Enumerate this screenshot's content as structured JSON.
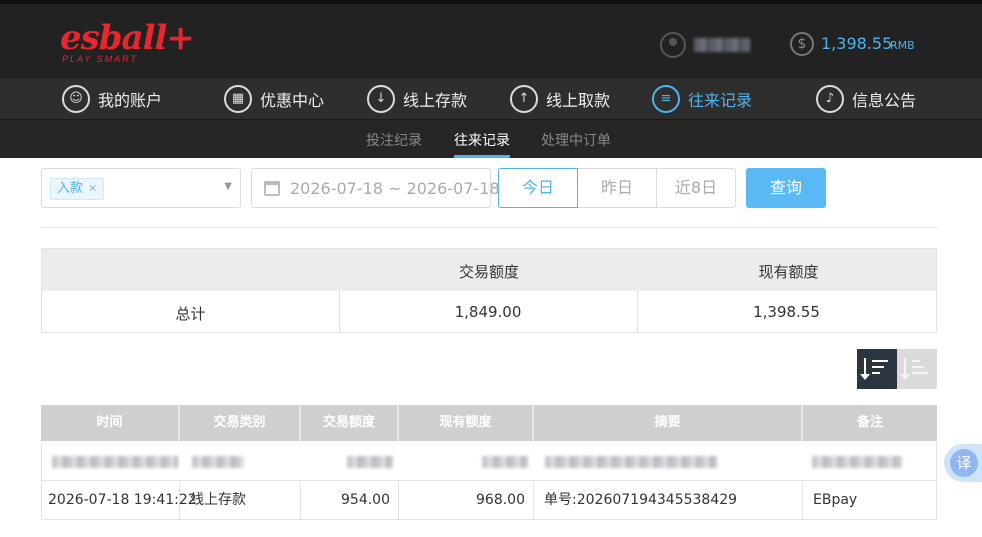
{
  "header": {
    "logo_text": "esball+",
    "logo_tagline": "PLAY SMART",
    "balance_value": "1,398.55",
    "balance_currency": "RMB",
    "icons": {
      "user": "user-icon",
      "balance": "dollar-coin-icon"
    }
  },
  "nav": {
    "items": [
      {
        "label": "我的账户",
        "icon": "user-icon"
      },
      {
        "label": "优惠中心",
        "icon": "gift-icon"
      },
      {
        "label": "线上存款",
        "icon": "deposit-icon"
      },
      {
        "label": "线上取款",
        "icon": "withdraw-icon"
      },
      {
        "label": "往来记录",
        "icon": "records-icon",
        "active": true
      },
      {
        "label": "信息公告",
        "icon": "bell-icon"
      }
    ]
  },
  "subnav": {
    "items": [
      {
        "label": "投注纪录"
      },
      {
        "label": "往来记录",
        "active": true
      },
      {
        "label": "处理中订单"
      }
    ]
  },
  "filters": {
    "type_tag": "入款",
    "date_range": "2026-07-18 ~ 2026-07-18",
    "quick_ranges": [
      "今日",
      "昨日",
      "近8日"
    ],
    "active_range": "今日",
    "query_label": "查询"
  },
  "summary": {
    "headers": [
      "",
      "交易额度",
      "现有额度"
    ],
    "total_label": "总计",
    "total_amount": "1,849.00",
    "current_balance": "1,398.55"
  },
  "records": {
    "columns": [
      "时间",
      "交易类别",
      "交易额度",
      "现有额度",
      "摘要",
      "备注"
    ],
    "rows": [
      {
        "time": "2026-07-18 19:41:22",
        "type": "线上存款",
        "amount": "954.00",
        "balance": "968.00",
        "summary": "单号:202607194345538429",
        "note": "EBpay"
      }
    ]
  },
  "translate_widget": {
    "label": "译"
  },
  "colors": {
    "accent": "#4fb3f0",
    "brand_red": "#e8262d",
    "topbar": "#222222",
    "sort_active": "#2b3540"
  }
}
